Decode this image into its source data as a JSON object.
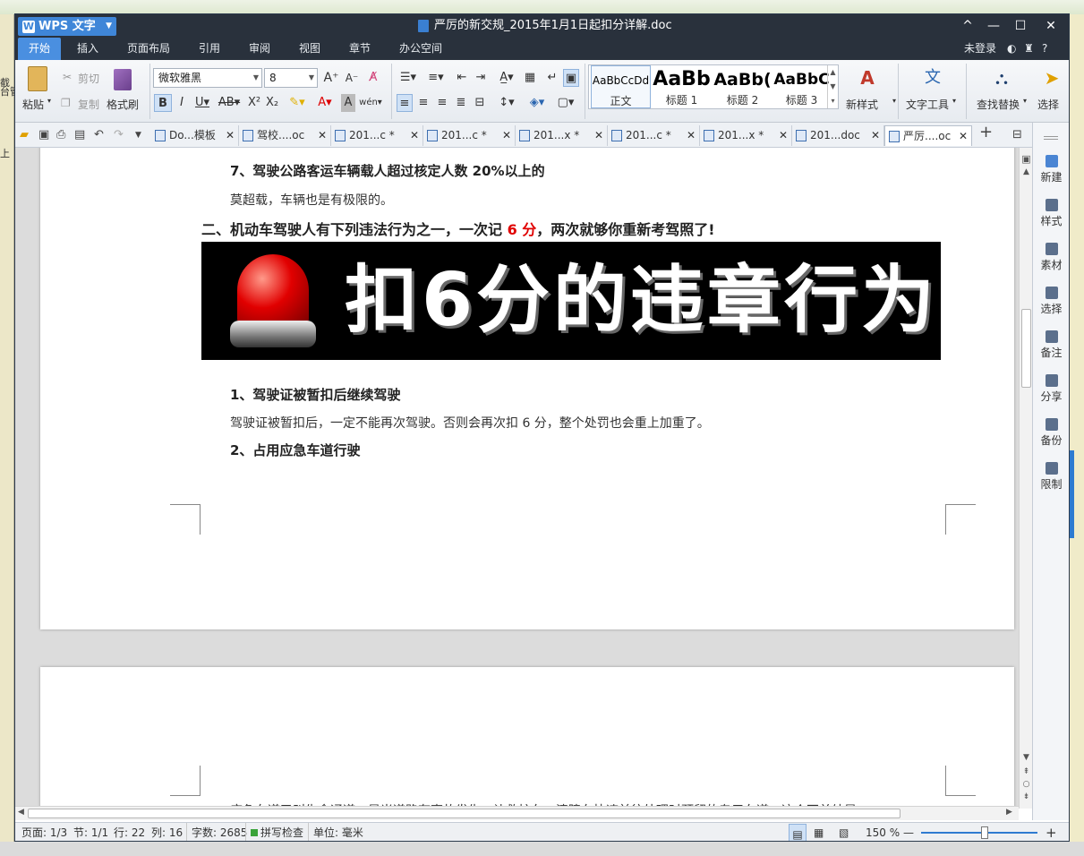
{
  "bg": {
    "left_texts": [
      "截",
      "台管",
      "上"
    ]
  },
  "window": {
    "app_button": "WPS 文字",
    "title": "严厉的新交规_2015年1月1日起扣分详解.doc",
    "controls": [
      "^",
      "—",
      "☐",
      "✕"
    ]
  },
  "menu": {
    "tabs": [
      "开始",
      "插入",
      "页面布局",
      "引用",
      "审阅",
      "视图",
      "章节",
      "办公空间"
    ],
    "right": [
      "未登录",
      "?"
    ]
  },
  "ribbon": {
    "paste": "粘贴",
    "cut": "剪切",
    "copy": "复制",
    "format_painter": "格式刷",
    "font_name": "微软雅黑",
    "font_size": "8",
    "styles": [
      {
        "preview": "AaBbCcDd",
        "label": "正文"
      },
      {
        "preview": "AaBb",
        "label": "标题 1"
      },
      {
        "preview": "AaBb(",
        "label": "标题 2"
      },
      {
        "preview": "AaBbC",
        "label": "标题 3"
      }
    ],
    "new_style": "新样式",
    "text_tools": "文字工具",
    "find_replace": "查找替换",
    "select": "选择"
  },
  "doc_tabs": [
    {
      "label": "Do...模板",
      "active": false
    },
    {
      "label": "驾校....oc",
      "active": false
    },
    {
      "label": "201...c *",
      "active": false
    },
    {
      "label": "201...c *",
      "active": false
    },
    {
      "label": "201...x *",
      "active": false
    },
    {
      "label": "201...c *",
      "active": false
    },
    {
      "label": "201...x *",
      "active": false
    },
    {
      "label": "201...doc",
      "active": false
    },
    {
      "label": "严厉....oc",
      "active": true
    }
  ],
  "document": {
    "line1": "7、驾驶公路客运车辆载人超过核定人数 20%以上的",
    "line2": "莫超载，车辆也是有极限的。",
    "heading_a": "二、机动车驾驶人有下列违法行为之一，一次记 ",
    "heading_red": "6 分",
    "heading_b": "，两次就够你重新考驾照了!",
    "banner_text": "扣6分的违章行为",
    "item1_title": "1、驾驶证被暂扣后继续驾驶",
    "item1_body": "驾驶证被暂扣后，一定不能再次驾驶。否则会再次扣 6 分，整个处罚也会重上加重了。",
    "item2_title": "2、占用应急车道行驶",
    "page2_line": "应急车道又叫生命通道，是当道路有事故发生，让救护车、清障车快速前往处理时预留的专用车道。这个不单纯是"
  },
  "right_panel": [
    "新建",
    "样式",
    "素材",
    "选择",
    "备注",
    "分享",
    "备份",
    "限制"
  ],
  "status": {
    "page": "页面: 1/3",
    "section": "节: 1/1",
    "row": "行: 22",
    "col": "列: 16",
    "words": "字数: 2685",
    "spell": "拼写检查",
    "unit": "单位: 毫米",
    "zoom": "150 %"
  }
}
